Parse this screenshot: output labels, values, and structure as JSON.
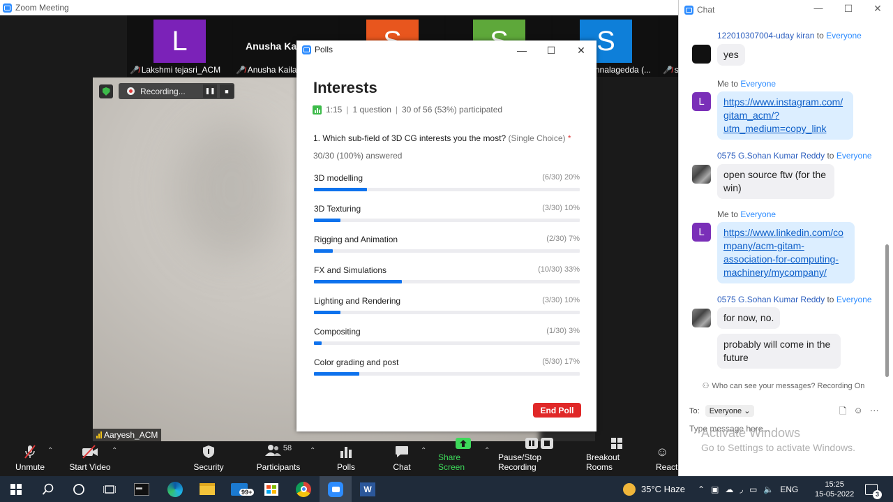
{
  "zoom": {
    "title": "Zoom Meeting"
  },
  "thumbnails": [
    {
      "initial": "L",
      "name": "Lakshmi tejasri_ACM",
      "color": "#7b22b8"
    },
    {
      "name_big": "Anusha Ka",
      "name": "Anusha Kaila"
    },
    {
      "initial": "S",
      "color": "#e8561e"
    },
    {
      "initial": "S",
      "color": "#5ea83a"
    },
    {
      "initial": "S",
      "name": "nnalagedda (...",
      "color": "#0e7fd9"
    },
    {
      "name": "s"
    }
  ],
  "recording": {
    "label": "Recording..."
  },
  "speaker": {
    "name": "Aaryesh_ACM"
  },
  "toolbar": {
    "unmute": "Unmute",
    "start_video": "Start Video",
    "security": "Security",
    "participants": "Participants",
    "participants_count": "58",
    "polls": "Polls",
    "chat": "Chat",
    "share_screen": "Share Screen",
    "pause_recording": "Pause/Stop Recording",
    "breakout": "Breakout Rooms",
    "reactions": "React"
  },
  "polls": {
    "window_title": "Polls",
    "heading": "Interests",
    "duration": "1:15",
    "questions": "1 question",
    "participated": "30 of 56 (53%) participated",
    "question": "1. Which sub-field of 3D CG interests you the most?",
    "question_type": "(Single Choice)",
    "required_mark": "*",
    "answered": "30/30 (100%) answered",
    "options": [
      {
        "label": "3D modelling",
        "stat": "(6/30) 20%",
        "pct": 20
      },
      {
        "label": "3D Texturing",
        "stat": "(3/30) 10%",
        "pct": 10
      },
      {
        "label": "Rigging and Animation",
        "stat": "(2/30) 7%",
        "pct": 7
      },
      {
        "label": "FX and Simulations",
        "stat": "(10/30) 33%",
        "pct": 33
      },
      {
        "label": "Lighting and Rendering",
        "stat": "(3/30) 10%",
        "pct": 10
      },
      {
        "label": "Compositing",
        "stat": "(1/30) 3%",
        "pct": 3
      },
      {
        "label": "Color grading and post",
        "stat": "(5/30) 17%",
        "pct": 17
      }
    ],
    "end_button": "End Poll"
  },
  "chat": {
    "window_title": "Chat",
    "messages": [
      {
        "from": "122010307004-uday kiran",
        "to_word": "to",
        "to": "Everyone",
        "text": "yes"
      },
      {
        "from": "Me",
        "to_word": "to",
        "to": "Everyone",
        "link": "https://www.instagram.com/gitam_acm/?utm_medium=copy_link",
        "link_lines": [
          "https://www.instagram.com/",
          "gitam_acm/?",
          "utm_medium=copy_link"
        ]
      },
      {
        "from": "0575 G.Sohan Kumar Reddy",
        "to_word": "to",
        "to": "Everyone",
        "text": "open source ftw (for the win)"
      },
      {
        "from": "Me",
        "to_word": "to",
        "to": "Everyone",
        "link": "https://www.linkedin.com/company/acm-gitam-association-for-computing-machinery/mycompany/",
        "link_lines": [
          "https://www.linkedin.com/co",
          "mpany/acm-gitam-",
          "association-for-computing-",
          "machinery/mycompany/"
        ]
      },
      {
        "from": "0575 G.Sohan Kumar Reddy",
        "to_word": "to",
        "to": "Everyone",
        "text": "for now, no.",
        "text2": "probably will come in the future"
      }
    ],
    "privacy_note": "Who can see your messages? Recording On",
    "to_label": "To:",
    "to_value": "Everyone",
    "input_placeholder": "Type message here..."
  },
  "watermark": {
    "line1": "Activate Windows",
    "line2": "Go to Settings to activate Windows."
  },
  "taskbar": {
    "weather": "35°C  Haze",
    "lang": "ENG",
    "time": "15:25",
    "date": "15-05-2022",
    "mail_badge": "99+",
    "notif_count": "3"
  }
}
